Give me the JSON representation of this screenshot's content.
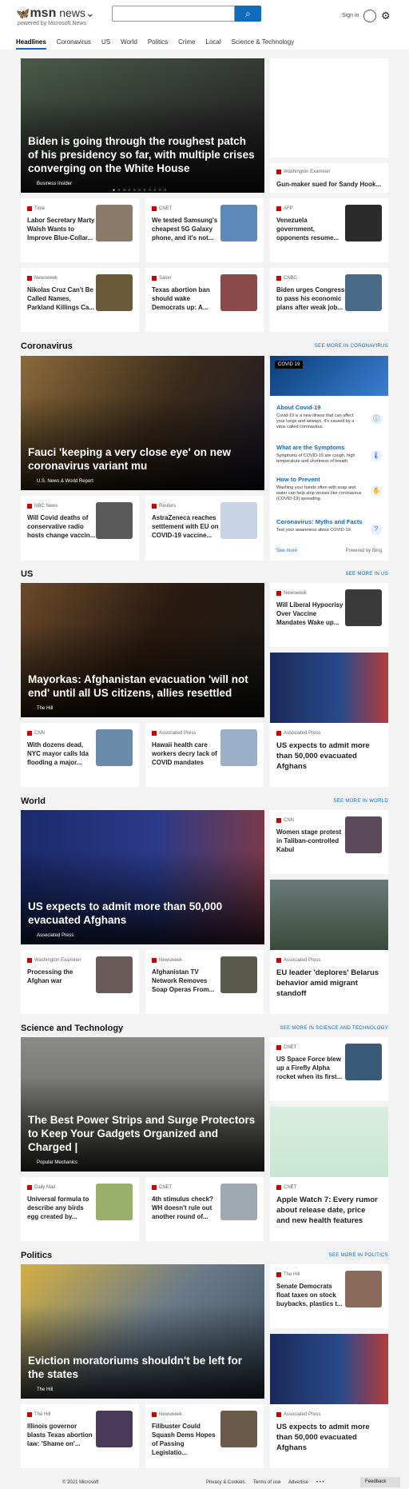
{
  "brand": {
    "msn": "msn",
    "news": "news",
    "sub": "powered by Microsoft News"
  },
  "header": {
    "signin": "Sign in"
  },
  "nav": [
    "Headlines",
    "Coronavirus",
    "US",
    "World",
    "Politics",
    "Crime",
    "Local",
    "Science & Technology"
  ],
  "top": {
    "hero": {
      "title": "Biden is going through the roughest patch of his presidency so far, with multiple crises converging on the White House",
      "source": "Business Insider"
    },
    "side": {
      "source": "Washington Examiner",
      "title": "Gun-maker sued for Sandy Hook..."
    },
    "row1": [
      {
        "source": "Time",
        "title": "Labor Secretary Marty Walsh Wants to Improve Blue-Collar..."
      },
      {
        "source": "CNET",
        "title": "We tested Samsung's cheapest 5G Galaxy phone, and it's not..."
      },
      {
        "source": "AFP",
        "title": "Venezuela government, opponents resume..."
      }
    ],
    "row2": [
      {
        "source": "Newsweek",
        "title": "Nikolas Cruz Can't Be Called Names, Parkland Killings Ca..."
      },
      {
        "source": "Salon",
        "title": "Texas abortion ban should wake Democrats up: A..."
      },
      {
        "source": "CNBC",
        "title": "Biden urges Congress to pass his economic plans after weak job..."
      }
    ]
  },
  "corona": {
    "title": "Coronavirus",
    "more": "SEE MORE IN CORONAVIRUS",
    "hero": {
      "title": "Fauci 'keeping a very close eye' on new coronavirus variant mu",
      "source": "U.S. News & World Report"
    },
    "row": [
      {
        "source": "NBC News",
        "title": "Will Covid deaths of conservative radio hosts change vaccin..."
      },
      {
        "source": "Reuters",
        "title": "AstraZeneca reaches settlement with EU on COVID-19 vaccine..."
      }
    ],
    "panel": {
      "tag": "COVID 19",
      "items": [
        {
          "h": "About Covid-19",
          "p": "Covid-19 is a new illness that can affect your lungs and airways. It's caused by a virus called coronavirus."
        },
        {
          "h": "What are the Symptoms",
          "p": "Symptoms of COVID-19 are cough, high temperature and shortness of breath."
        },
        {
          "h": "How to Prevent",
          "p": "Washing your hands often with soap and water can help stop viruses like coronavirus (COVID-19) spreading."
        },
        {
          "h": "Coronavirus: Myths and Facts",
          "p": "Test your awareness about COVID-19."
        }
      ],
      "see_more": "See more",
      "powered": "Powered by Bing"
    }
  },
  "us": {
    "title": "US",
    "more": "SEE MORE IN US",
    "hero": {
      "title": "Mayorkas: Afghanistan evacuation 'will not end' until all US citizens, allies resettled",
      "source": "The Hill"
    },
    "side": {
      "source": "Newsweek",
      "title": "Will Liberal Hypocrisy Over Vaccine Mandates Wake up..."
    },
    "tall": {
      "source": "Associated Press",
      "title": "US expects to admit more than 50,000 evacuated Afghans"
    },
    "row": [
      {
        "source": "CNN",
        "title": "With dozens dead, NYC mayor calls Ida flooding a major..."
      },
      {
        "source": "Associated Press",
        "title": "Hawaii health care workers decry lack of COVID mandates"
      }
    ]
  },
  "world": {
    "title": "World",
    "more": "SEE MORE IN WORLD",
    "hero": {
      "title": "US expects to admit more than 50,000 evacuated Afghans",
      "source": "Associated Press"
    },
    "side": {
      "source": "CNN",
      "title": "Women stage protest in Taliban-controlled Kabul"
    },
    "tall": {
      "source": "Associated Press",
      "title": "EU leader 'deplores' Belarus behavior amid migrant standoff"
    },
    "row": [
      {
        "source": "Washington Examiner",
        "title": "Processing the Afghan war"
      },
      {
        "source": "Newsweek",
        "title": "Afghanistan TV Network Removes Soap Operas From..."
      }
    ]
  },
  "sci": {
    "title": "Science and Technology",
    "more": "SEE MORE IN SCIENCE AND TECHNOLOGY",
    "hero": {
      "title": "The Best Power Strips and Surge Protectors to Keep Your Gadgets Organized and Charged |",
      "source": "Popular Mechanics"
    },
    "side": {
      "source": "CNET",
      "title": "US Space Force blew up a Firefly Alpha rocket when its first..."
    },
    "tall": {
      "source": "CNET",
      "title": "Apple Watch 7: Every rumor about release date, price and new health features"
    },
    "row": [
      {
        "source": "Daily Mail",
        "title": "Universal formula to describe any birds egg created by..."
      },
      {
        "source": "CNET",
        "title": "4th stimulus check? WH doesn't rule out another round of..."
      }
    ]
  },
  "politics": {
    "title": "Politics",
    "more": "SEE MORE IN POLITICS",
    "hero": {
      "title": "Eviction moratoriums shouldn't be left for the states",
      "source": "The Hill"
    },
    "side": {
      "source": "The Hill",
      "title": "Senate Democrats float taxes on stock buybacks, plastics t..."
    },
    "tall": {
      "source": "Associated Press",
      "title": "US expects to admit more than 50,000 evacuated Afghans"
    },
    "row": [
      {
        "source": "The Hill",
        "title": "Illinois governor blasts Texas abortion law: 'Shame on'..."
      },
      {
        "source": "Newsweek",
        "title": "Filibuster Could Squash Dems Hopes of Passing Legislatio..."
      }
    ]
  },
  "footer": {
    "copyright": "© 2021 Microsoft",
    "privacy": "Privacy & Cookies",
    "terms": "Terms of use",
    "advertise": "Advertise",
    "more": "• • •",
    "feedback": "Feedback"
  }
}
